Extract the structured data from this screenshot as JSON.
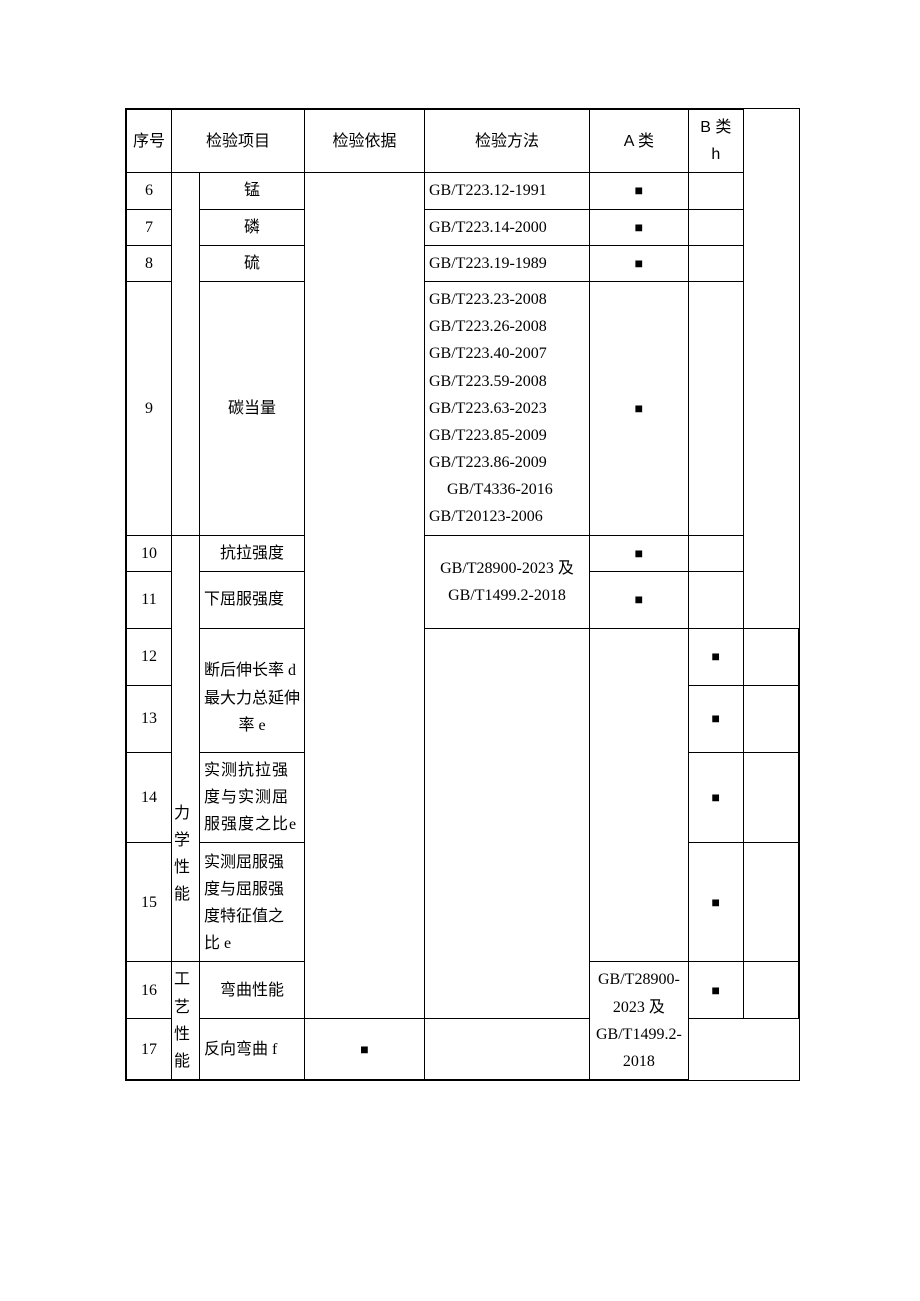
{
  "headers": {
    "seq": "序号",
    "item": "检验项目",
    "basis": "检验依据",
    "method": "检验方法",
    "a": "A 类",
    "b": "B 类 h"
  },
  "chart_data": {
    "type": "table",
    "columns": [
      "序号",
      "检验项目-分类",
      "检验项目-子项",
      "检验依据",
      "检验方法",
      "A 类",
      "B 类 h"
    ],
    "rows": [
      {
        "seq": "6",
        "category": "",
        "item": "锰",
        "basis": "",
        "method": "GB/T223.12-1991",
        "a": "■",
        "b": ""
      },
      {
        "seq": "7",
        "category": "",
        "item": "磷",
        "basis": "",
        "method": "GB/T223.14-2000",
        "a": "■",
        "b": ""
      },
      {
        "seq": "8",
        "category": "",
        "item": "硫",
        "basis": "",
        "method": "GB/T223.19-1989",
        "a": "■",
        "b": ""
      },
      {
        "seq": "9",
        "category": "",
        "item": "碳当量",
        "basis": "",
        "method": "GB/T223.23-2008 GB/T223.26-2008 GB/T223.40-2007 GB/T223.59-2008 GB/T223.63-2023 GB/T223.85-2009 GB/T223.86-2009 GB/T4336-2016 GB/T20123-2006",
        "a": "■",
        "b": ""
      },
      {
        "seq": "10",
        "category": "力学性能",
        "item": "抗拉强度",
        "basis": "",
        "method": "",
        "a": "■",
        "b": ""
      },
      {
        "seq": "11",
        "category": "力学性能",
        "item": "下屈服强度",
        "basis": "",
        "method": "GB/T28900-2023 及 GB/T1499.2-2018",
        "a": "■",
        "b": ""
      },
      {
        "seq": "12",
        "category": "力学性能",
        "item": "断后伸长率 d",
        "basis": "",
        "method": "",
        "a": "■",
        "b": ""
      },
      {
        "seq": "13",
        "category": "力学性能",
        "item": "最大力总延伸率 e",
        "basis": "",
        "method": "",
        "a": "■",
        "b": ""
      },
      {
        "seq": "14",
        "category": "力学性能",
        "item": "实测抗拉强度与实测屈服强度之比 e",
        "basis": "",
        "method": "",
        "a": "■",
        "b": ""
      },
      {
        "seq": "15",
        "category": "力学性能",
        "item": "实测屈服强度与屈服强度特征值之比 e",
        "basis": "",
        "method": "",
        "a": "■",
        "b": ""
      },
      {
        "seq": "16",
        "category": "工艺性能",
        "item": "弯曲性能",
        "basis": "",
        "method": "",
        "a": "■",
        "b": ""
      },
      {
        "seq": "17",
        "category": "工艺性能",
        "item": "反向弯曲 f",
        "basis": "",
        "method": "GB/T28900-2023 及 GB/T1499.2-2018",
        "a": "■",
        "b": ""
      }
    ]
  },
  "rows": {
    "r6": {
      "seq": "6",
      "item": "锰",
      "method": "GB/T223.12-1991",
      "a": "■"
    },
    "r7": {
      "seq": "7",
      "item": "磷",
      "method": "GB/T223.14-2000",
      "a": "■"
    },
    "r8": {
      "seq": "8",
      "item": "硫",
      "method": "GB/T223.19-1989",
      "a": "■"
    },
    "r9": {
      "seq": "9",
      "item": "碳当量",
      "a": "■",
      "m1": "GB/T223.23-2008",
      "m2": "GB/T223.26-2008",
      "m3": "GB/T223.40-2007",
      "m4": "GB/T223.59-2008",
      "m5": "GB/T223.63-2023",
      "m6": "GB/T223.85-2009",
      "m7": "GB/T223.86-2009",
      "m8": "GB/T4336-2016",
      "m9": "GB/T20123-2006"
    },
    "r10": {
      "seq": "10",
      "item": "抗拉强度",
      "a": "■"
    },
    "r11": {
      "seq": "11",
      "item": "下屈服强度",
      "a": "■",
      "m1": "GB/T28900-2023 及",
      "m2": "GB/T1499.2-2018"
    },
    "r12": {
      "seq": "12",
      "item": "断后伸长率 d",
      "a": "■"
    },
    "r13": {
      "seq": "13",
      "item": "最大力总延伸率 e",
      "a": "■"
    },
    "r14": {
      "seq": "14",
      "item": "实测抗拉强度与实测屈服强度之比e",
      "a": "■"
    },
    "r15": {
      "seq": "15",
      "item": "实测屈服强度与屈服强度特征值之比 e",
      "a": "■"
    },
    "r16": {
      "seq": "16",
      "item": "弯曲性能",
      "a": "■"
    },
    "r17": {
      "seq": "17",
      "item": "反向弯曲 f",
      "a": "■",
      "m1": "GB/T28900-2023 及",
      "m2": "GB/T1499.2-2018"
    }
  },
  "categories": {
    "mech": "力学性能",
    "proc": "工艺性能"
  }
}
